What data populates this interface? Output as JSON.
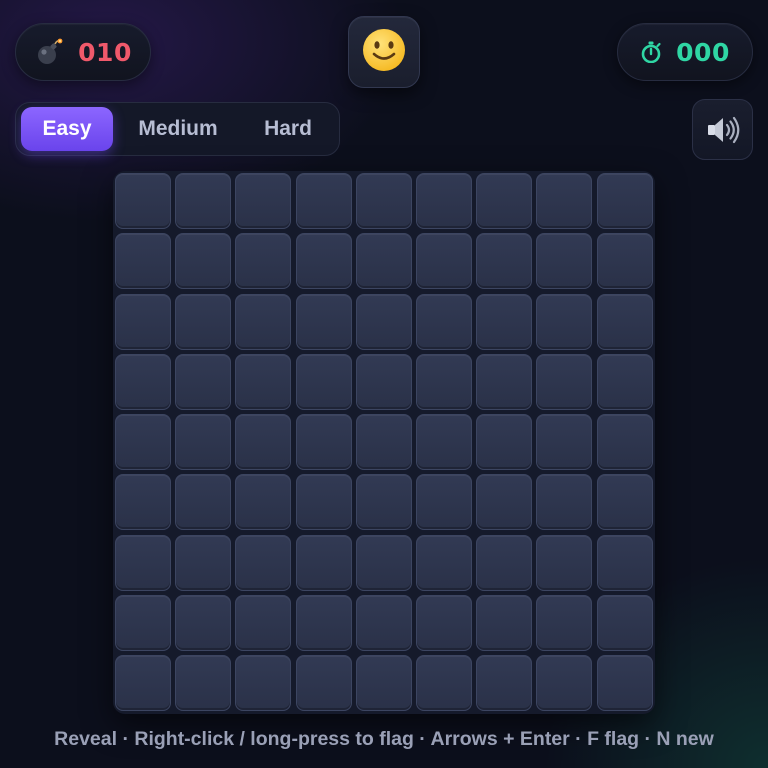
{
  "header": {
    "mines_remaining": "010",
    "timer": "000",
    "mine_icon": "bomb-icon",
    "timer_icon": "stopwatch-icon",
    "face_icon": "smiley-face-icon",
    "sound_icon": "speaker-icon"
  },
  "difficulty": {
    "options": [
      "Easy",
      "Medium",
      "Hard"
    ],
    "selected": "Easy"
  },
  "board": {
    "rows": 9,
    "cols": 9,
    "state": "all-unrevealed"
  },
  "help_text": "Reveal · Right-click / long-press to flag · Arrows + Enter · F flag · N new",
  "colors": {
    "mine_counter": "#f0596b",
    "timer": "#2fd6a4",
    "accent": "#7a55f7",
    "cell": "#2e3650",
    "background": "#0c0f1c"
  }
}
